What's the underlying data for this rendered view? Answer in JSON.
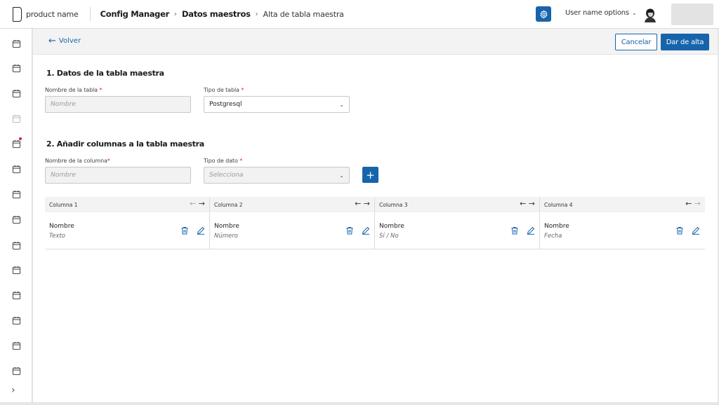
{
  "header": {
    "product_name": "product name",
    "breadcrumb": [
      "Config Manager",
      "Datos maestros",
      "Alta de tabla maestra"
    ],
    "user_options": "User name options"
  },
  "actions": {
    "back_label": "Volver",
    "cancel_label": "Cancelar",
    "submit_label": "Dar de alta"
  },
  "section1": {
    "title": "1. Datos de la tabla maestra",
    "table_name_label": "Nombre de la tabla",
    "table_name_placeholder": "Nombre",
    "table_type_label": "Tipo de tabla",
    "table_type_value": "Postgresql"
  },
  "section2": {
    "title": "2. Añadir columnas a la tabla maestra",
    "column_name_label": "Nombre de la columna",
    "column_name_placeholder": "Nombre",
    "data_type_label": "Tipo de dato",
    "data_type_placeholder": "Selecciona",
    "add_label": "+"
  },
  "required_mark": "*",
  "columns": [
    {
      "title": "Columna 1",
      "name": "Nombre",
      "type": "Texto"
    },
    {
      "title": "Columna 2",
      "name": "Nombre",
      "type": "Número"
    },
    {
      "title": "Columna 3",
      "name": "Nombre",
      "type": "Sí / No"
    },
    {
      "title": "Columna 4",
      "name": "Nombre",
      "type": "Fecha"
    }
  ],
  "colors": {
    "primary": "#1764ab",
    "alert": "#d2243f"
  },
  "icons": {
    "settings": "gear-icon",
    "sidebar": "calendar-icon",
    "delete": "trash-icon",
    "edit": "pencil-icon",
    "expand": "chevron-right-icon"
  }
}
